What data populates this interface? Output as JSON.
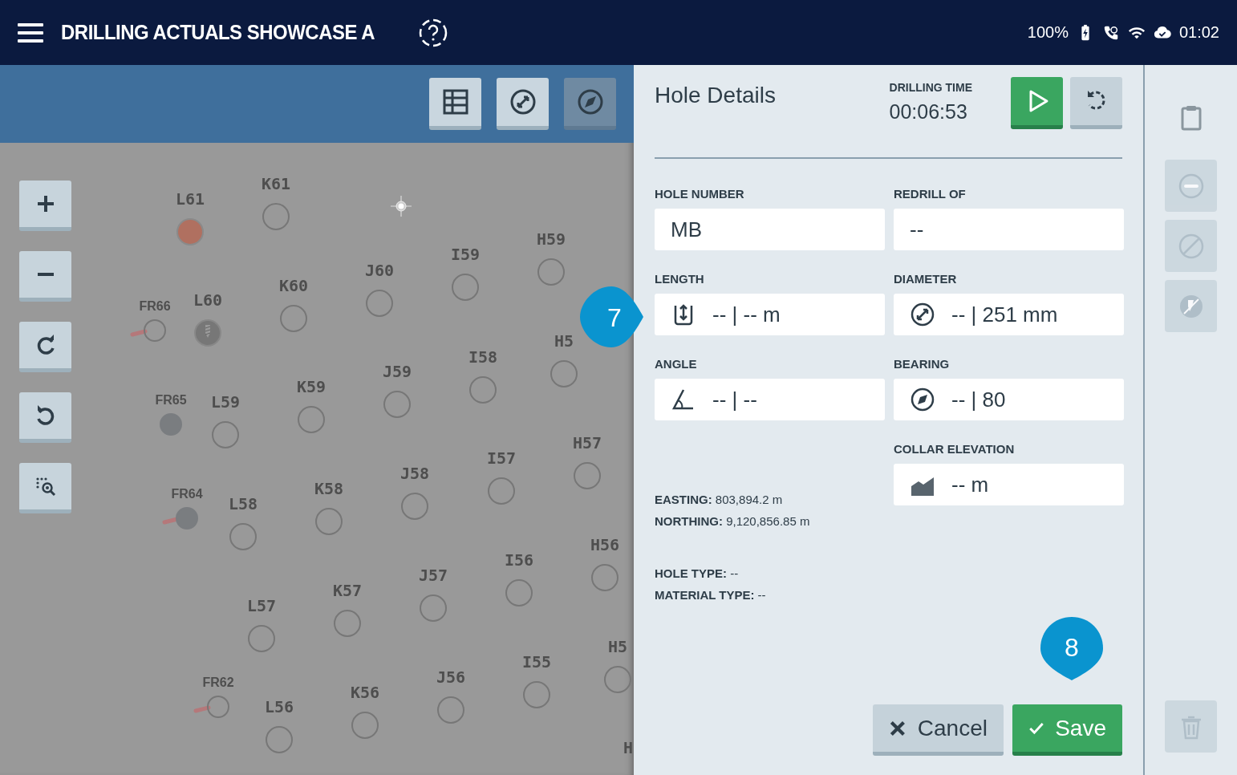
{
  "top_bar": {
    "title": "DRILLING ACTUALS SHOWCASE A",
    "battery": "100%",
    "time": "01:02"
  },
  "map": {
    "tools": [
      {
        "disabled": false
      },
      {
        "disabled": false
      },
      {
        "disabled": true
      }
    ],
    "holes": [
      {
        "label": "L61",
        "kind": "drilled"
      },
      {
        "label": "K61",
        "kind": "open"
      },
      {
        "label": "FR66",
        "kind": "marker",
        "tail": true
      },
      {
        "label": "L60",
        "kind": "drilling"
      },
      {
        "label": "K60",
        "kind": "open"
      },
      {
        "label": "J60",
        "kind": "open"
      },
      {
        "label": "I59",
        "kind": "open"
      },
      {
        "label": "H59",
        "kind": "open"
      },
      {
        "label": "FR65",
        "kind": "filled-marker",
        "tail": false
      },
      {
        "label": "L59",
        "kind": "open"
      },
      {
        "label": "K59",
        "kind": "open"
      },
      {
        "label": "J59",
        "kind": "open"
      },
      {
        "label": "I58",
        "kind": "open"
      },
      {
        "label": "H5",
        "kind": "open"
      },
      {
        "label": "FR64",
        "kind": "filled-marker",
        "tail": true
      },
      {
        "label": "L58",
        "kind": "open"
      },
      {
        "label": "K58",
        "kind": "open"
      },
      {
        "label": "J58",
        "kind": "open"
      },
      {
        "label": "I57",
        "kind": "open"
      },
      {
        "label": "H57",
        "kind": "open"
      },
      {
        "label": "L57",
        "kind": "open"
      },
      {
        "label": "K57",
        "kind": "open"
      },
      {
        "label": "J57",
        "kind": "open"
      },
      {
        "label": "I56",
        "kind": "open"
      },
      {
        "label": "H56",
        "kind": "open"
      },
      {
        "label": "FR62",
        "kind": "marker",
        "tail": true
      },
      {
        "label": "L56",
        "kind": "open"
      },
      {
        "label": "K56",
        "kind": "open"
      },
      {
        "label": "J56",
        "kind": "open"
      },
      {
        "label": "I55",
        "kind": "open"
      },
      {
        "label": "H5",
        "kind": "open"
      },
      {
        "label": "H",
        "kind": "label"
      }
    ]
  },
  "panel": {
    "title": "Hole Details",
    "timer_label": "DRILLING TIME",
    "timer": "00:06:53",
    "fields": [
      {
        "label": "HOLE NUMBER",
        "value": "MB"
      },
      {
        "label": "REDRILL OF",
        "value": "--"
      },
      {
        "label": "LENGTH",
        "value": "-- | -- m"
      },
      {
        "label": "DIAMETER",
        "value": "-- | 251 mm"
      },
      {
        "label": "ANGLE",
        "value": "-- | --"
      },
      {
        "label": "BEARING",
        "value": "-- | 80"
      },
      {
        "label": "COLLAR ELEVATION",
        "value": "-- m"
      }
    ],
    "coordinates": [
      "**EASTING:** 803,894.2 m",
      "**NORTHING:** 9,120,856.85 m"
    ],
    "types": [
      "**HOLE TYPE:** --",
      "**MATERIAL TYPE:** --"
    ],
    "buttons": [
      {
        "kind": "cancel",
        "label": "Cancel"
      },
      {
        "kind": "save",
        "label": "Save"
      }
    ]
  },
  "rail": [
    {
      "kind": "clipboard",
      "disabled": false
    },
    {
      "kind": "minus",
      "disabled": true
    },
    {
      "kind": "block",
      "disabled": true
    },
    {
      "kind": "nodrill",
      "disabled": true
    },
    {
      "kind": "trash",
      "disabled": true
    }
  ],
  "callouts": [
    {
      "number": "7"
    },
    {
      "number": "8"
    }
  ]
}
